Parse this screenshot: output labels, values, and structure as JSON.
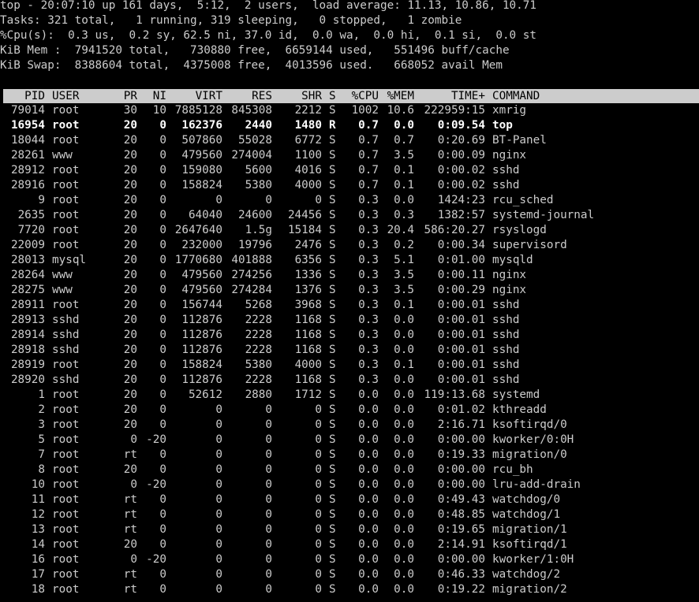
{
  "summary": [
    "top - 20:07:10 up 161 days,  5:12,  2 users,  load average: 11.13, 10.86, 10.71",
    "Tasks: 321 total,   1 running, 319 sleeping,   0 stopped,   1 zombie",
    "%Cpu(s):  0.3 us,  0.2 sy, 62.5 ni, 37.0 id,  0.0 wa,  0.0 hi,  0.1 si,  0.0 st",
    "KiB Mem :  7941520 total,   730880 free,  6659144 used,   551496 buff/cache",
    "KiB Swap:  8388604 total,  4375008 free,  4013596 used.   668052 avail Mem"
  ],
  "columns": {
    "pid": "PID",
    "user": "USER",
    "pr": "PR",
    "ni": "NI",
    "virt": "VIRT",
    "res": "RES",
    "shr": "SHR",
    "s": "S",
    "cpu": "%CPU",
    "mem": "%MEM",
    "time": "TIME+",
    "command": "COMMAND"
  },
  "processes": [
    {
      "pid": "79014",
      "user": "root",
      "pr": "30",
      "ni": "10",
      "virt": "7885128",
      "res": "845308",
      "shr": "2212",
      "s": "S",
      "cpu": "1002",
      "mem": "10.6",
      "time": "222959:15",
      "command": "xmrig",
      "highlight": false
    },
    {
      "pid": "16954",
      "user": "root",
      "pr": "20",
      "ni": "0",
      "virt": "162376",
      "res": "2440",
      "shr": "1480",
      "s": "R",
      "cpu": "0.7",
      "mem": "0.0",
      "time": "0:09.54",
      "command": "top",
      "highlight": true
    },
    {
      "pid": "18044",
      "user": "root",
      "pr": "20",
      "ni": "0",
      "virt": "507860",
      "res": "55028",
      "shr": "6772",
      "s": "S",
      "cpu": "0.7",
      "mem": "0.7",
      "time": "0:20.69",
      "command": "BT-Panel",
      "highlight": false
    },
    {
      "pid": "28261",
      "user": "www",
      "pr": "20",
      "ni": "0",
      "virt": "479560",
      "res": "274004",
      "shr": "1100",
      "s": "S",
      "cpu": "0.7",
      "mem": "3.5",
      "time": "0:00.09",
      "command": "nginx",
      "highlight": false
    },
    {
      "pid": "28912",
      "user": "root",
      "pr": "20",
      "ni": "0",
      "virt": "159080",
      "res": "5600",
      "shr": "4016",
      "s": "S",
      "cpu": "0.7",
      "mem": "0.1",
      "time": "0:00.02",
      "command": "sshd",
      "highlight": false
    },
    {
      "pid": "28916",
      "user": "root",
      "pr": "20",
      "ni": "0",
      "virt": "158824",
      "res": "5380",
      "shr": "4000",
      "s": "S",
      "cpu": "0.7",
      "mem": "0.1",
      "time": "0:00.02",
      "command": "sshd",
      "highlight": false
    },
    {
      "pid": "9",
      "user": "root",
      "pr": "20",
      "ni": "0",
      "virt": "0",
      "res": "0",
      "shr": "0",
      "s": "S",
      "cpu": "0.3",
      "mem": "0.0",
      "time": "1424:23",
      "command": "rcu_sched",
      "highlight": false
    },
    {
      "pid": "2635",
      "user": "root",
      "pr": "20",
      "ni": "0",
      "virt": "64040",
      "res": "24600",
      "shr": "24456",
      "s": "S",
      "cpu": "0.3",
      "mem": "0.3",
      "time": "1382:57",
      "command": "systemd-journal",
      "highlight": false
    },
    {
      "pid": "7720",
      "user": "root",
      "pr": "20",
      "ni": "0",
      "virt": "2647640",
      "res": "1.5g",
      "shr": "15184",
      "s": "S",
      "cpu": "0.3",
      "mem": "20.4",
      "time": "586:20.27",
      "command": "rsyslogd",
      "highlight": false
    },
    {
      "pid": "22009",
      "user": "root",
      "pr": "20",
      "ni": "0",
      "virt": "232000",
      "res": "19796",
      "shr": "2476",
      "s": "S",
      "cpu": "0.3",
      "mem": "0.2",
      "time": "0:00.34",
      "command": "supervisord",
      "highlight": false
    },
    {
      "pid": "28013",
      "user": "mysql",
      "pr": "20",
      "ni": "0",
      "virt": "1770680",
      "res": "401888",
      "shr": "6356",
      "s": "S",
      "cpu": "0.3",
      "mem": "5.1",
      "time": "0:01.00",
      "command": "mysqld",
      "highlight": false
    },
    {
      "pid": "28264",
      "user": "www",
      "pr": "20",
      "ni": "0",
      "virt": "479560",
      "res": "274256",
      "shr": "1336",
      "s": "S",
      "cpu": "0.3",
      "mem": "3.5",
      "time": "0:00.11",
      "command": "nginx",
      "highlight": false
    },
    {
      "pid": "28275",
      "user": "www",
      "pr": "20",
      "ni": "0",
      "virt": "479560",
      "res": "274284",
      "shr": "1376",
      "s": "S",
      "cpu": "0.3",
      "mem": "3.5",
      "time": "0:00.29",
      "command": "nginx",
      "highlight": false
    },
    {
      "pid": "28911",
      "user": "root",
      "pr": "20",
      "ni": "0",
      "virt": "156744",
      "res": "5268",
      "shr": "3968",
      "s": "S",
      "cpu": "0.3",
      "mem": "0.1",
      "time": "0:00.01",
      "command": "sshd",
      "highlight": false
    },
    {
      "pid": "28913",
      "user": "sshd",
      "pr": "20",
      "ni": "0",
      "virt": "112876",
      "res": "2228",
      "shr": "1168",
      "s": "S",
      "cpu": "0.3",
      "mem": "0.0",
      "time": "0:00.01",
      "command": "sshd",
      "highlight": false
    },
    {
      "pid": "28914",
      "user": "sshd",
      "pr": "20",
      "ni": "0",
      "virt": "112876",
      "res": "2228",
      "shr": "1168",
      "s": "S",
      "cpu": "0.3",
      "mem": "0.0",
      "time": "0:00.01",
      "command": "sshd",
      "highlight": false
    },
    {
      "pid": "28918",
      "user": "sshd",
      "pr": "20",
      "ni": "0",
      "virt": "112876",
      "res": "2228",
      "shr": "1168",
      "s": "S",
      "cpu": "0.3",
      "mem": "0.0",
      "time": "0:00.01",
      "command": "sshd",
      "highlight": false
    },
    {
      "pid": "28919",
      "user": "root",
      "pr": "20",
      "ni": "0",
      "virt": "158824",
      "res": "5380",
      "shr": "4000",
      "s": "S",
      "cpu": "0.3",
      "mem": "0.1",
      "time": "0:00.01",
      "command": "sshd",
      "highlight": false
    },
    {
      "pid": "28920",
      "user": "sshd",
      "pr": "20",
      "ni": "0",
      "virt": "112876",
      "res": "2228",
      "shr": "1168",
      "s": "S",
      "cpu": "0.3",
      "mem": "0.0",
      "time": "0:00.01",
      "command": "sshd",
      "highlight": false
    },
    {
      "pid": "1",
      "user": "root",
      "pr": "20",
      "ni": "0",
      "virt": "52612",
      "res": "2880",
      "shr": "1712",
      "s": "S",
      "cpu": "0.0",
      "mem": "0.0",
      "time": "119:13.68",
      "command": "systemd",
      "highlight": false
    },
    {
      "pid": "2",
      "user": "root",
      "pr": "20",
      "ni": "0",
      "virt": "0",
      "res": "0",
      "shr": "0",
      "s": "S",
      "cpu": "0.0",
      "mem": "0.0",
      "time": "0:01.02",
      "command": "kthreadd",
      "highlight": false
    },
    {
      "pid": "3",
      "user": "root",
      "pr": "20",
      "ni": "0",
      "virt": "0",
      "res": "0",
      "shr": "0",
      "s": "S",
      "cpu": "0.0",
      "mem": "0.0",
      "time": "2:16.71",
      "command": "ksoftirqd/0",
      "highlight": false
    },
    {
      "pid": "5",
      "user": "root",
      "pr": "0",
      "ni": "-20",
      "virt": "0",
      "res": "0",
      "shr": "0",
      "s": "S",
      "cpu": "0.0",
      "mem": "0.0",
      "time": "0:00.00",
      "command": "kworker/0:0H",
      "highlight": false
    },
    {
      "pid": "7",
      "user": "root",
      "pr": "rt",
      "ni": "0",
      "virt": "0",
      "res": "0",
      "shr": "0",
      "s": "S",
      "cpu": "0.0",
      "mem": "0.0",
      "time": "0:19.33",
      "command": "migration/0",
      "highlight": false
    },
    {
      "pid": "8",
      "user": "root",
      "pr": "20",
      "ni": "0",
      "virt": "0",
      "res": "0",
      "shr": "0",
      "s": "S",
      "cpu": "0.0",
      "mem": "0.0",
      "time": "0:00.00",
      "command": "rcu_bh",
      "highlight": false
    },
    {
      "pid": "10",
      "user": "root",
      "pr": "0",
      "ni": "-20",
      "virt": "0",
      "res": "0",
      "shr": "0",
      "s": "S",
      "cpu": "0.0",
      "mem": "0.0",
      "time": "0:00.00",
      "command": "lru-add-drain",
      "highlight": false
    },
    {
      "pid": "11",
      "user": "root",
      "pr": "rt",
      "ni": "0",
      "virt": "0",
      "res": "0",
      "shr": "0",
      "s": "S",
      "cpu": "0.0",
      "mem": "0.0",
      "time": "0:49.43",
      "command": "watchdog/0",
      "highlight": false
    },
    {
      "pid": "12",
      "user": "root",
      "pr": "rt",
      "ni": "0",
      "virt": "0",
      "res": "0",
      "shr": "0",
      "s": "S",
      "cpu": "0.0",
      "mem": "0.0",
      "time": "0:48.85",
      "command": "watchdog/1",
      "highlight": false
    },
    {
      "pid": "13",
      "user": "root",
      "pr": "rt",
      "ni": "0",
      "virt": "0",
      "res": "0",
      "shr": "0",
      "s": "S",
      "cpu": "0.0",
      "mem": "0.0",
      "time": "0:19.65",
      "command": "migration/1",
      "highlight": false
    },
    {
      "pid": "14",
      "user": "root",
      "pr": "20",
      "ni": "0",
      "virt": "0",
      "res": "0",
      "shr": "0",
      "s": "S",
      "cpu": "0.0",
      "mem": "0.0",
      "time": "2:14.91",
      "command": "ksoftirqd/1",
      "highlight": false
    },
    {
      "pid": "16",
      "user": "root",
      "pr": "0",
      "ni": "-20",
      "virt": "0",
      "res": "0",
      "shr": "0",
      "s": "S",
      "cpu": "0.0",
      "mem": "0.0",
      "time": "0:00.00",
      "command": "kworker/1:0H",
      "highlight": false
    },
    {
      "pid": "17",
      "user": "root",
      "pr": "rt",
      "ni": "0",
      "virt": "0",
      "res": "0",
      "shr": "0",
      "s": "S",
      "cpu": "0.0",
      "mem": "0.0",
      "time": "0:46.33",
      "command": "watchdog/2",
      "highlight": false
    },
    {
      "pid": "18",
      "user": "root",
      "pr": "rt",
      "ni": "0",
      "virt": "0",
      "res": "0",
      "shr": "0",
      "s": "S",
      "cpu": "0.0",
      "mem": "0.0",
      "time": "0:19.22",
      "command": "migration/2",
      "highlight": false
    }
  ]
}
